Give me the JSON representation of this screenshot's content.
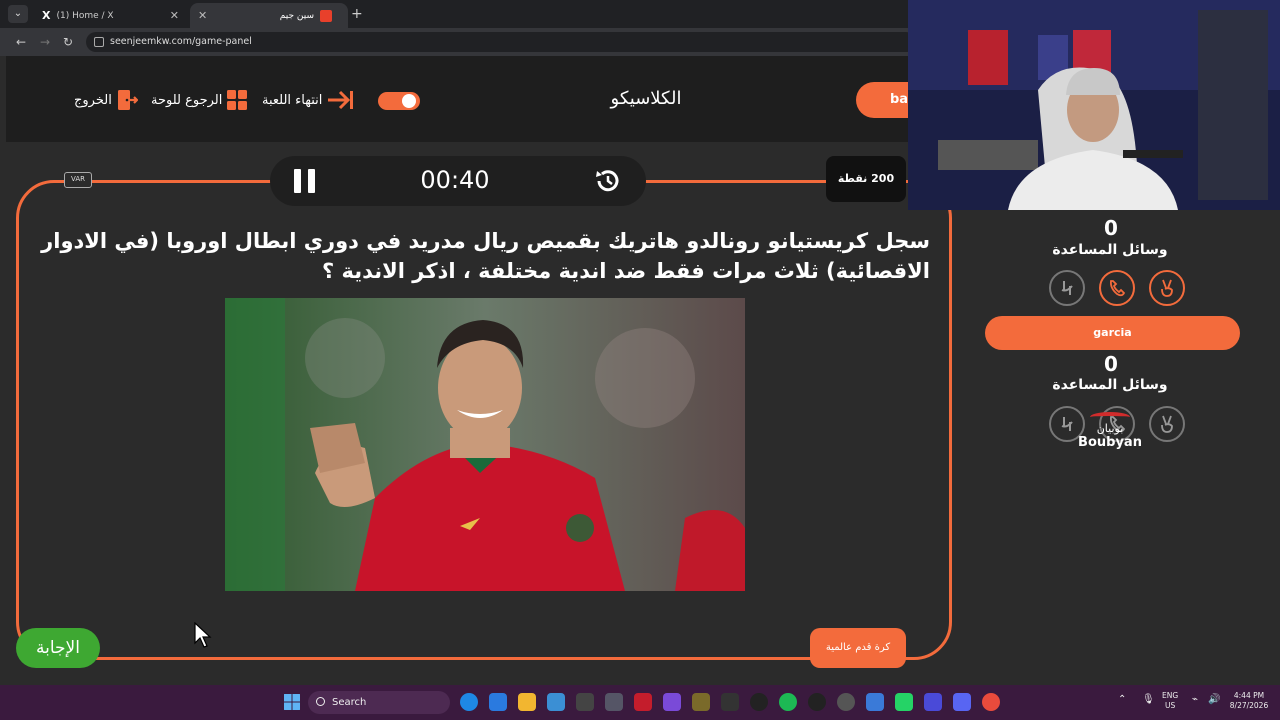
{
  "browser": {
    "tabs": [
      {
        "label": "(1) Home / X",
        "favicon": "x-logo-icon",
        "active": false
      },
      {
        "label": "سين جيم",
        "favicon": "seenjeem-icon",
        "active": true
      }
    ],
    "new_tab_label": "+",
    "url": "seenjeemkw.com/game-panel",
    "tab_x_glyph": "X"
  },
  "header": {
    "exit_label": "الخروج",
    "back_to_board_label": "الرجوع للوحة",
    "end_game_label": "انتهاء اللعبة",
    "game_title": "الكلاسيكو",
    "team_pill_label": "ba"
  },
  "question_panel": {
    "var_label": "VAR",
    "timer": "00:40",
    "points": "200 نقطة",
    "question_text": "سجل كريستيانو رونالدو هاتريك بقميص ريال مدريد في دوري ابطال اوروبا (في الادوار الاقصائية) ثلاث مرات فقط ضد اندية مختلفة ، اذكر الاندية ؟",
    "answer_label": "الإجابة",
    "category_label": "كرة قدم عالمية"
  },
  "scoreboard": {
    "team1": {
      "score": "0",
      "helpers_label": "وسائل المساعدة"
    },
    "team2": {
      "name": "garcia",
      "score": "0",
      "helpers_label": "وسائل المساعدة"
    },
    "helper_icons": [
      "two-hands-icon",
      "phone-icon",
      "peace-hand-icon"
    ],
    "sponsor_ar": "بوبيان",
    "sponsor_en": "Boubyan"
  },
  "taskbar": {
    "search_placeholder": "Search",
    "lang_top": "ENG",
    "lang_bottom": "US",
    "time": "4:44 PM",
    "date": "8/27/2026"
  },
  "colors": {
    "accent": "#f36b3c",
    "answer_green": "#3ea832",
    "header_bg": "#1e1e1e",
    "panel_bg": "#2b2b2b"
  }
}
